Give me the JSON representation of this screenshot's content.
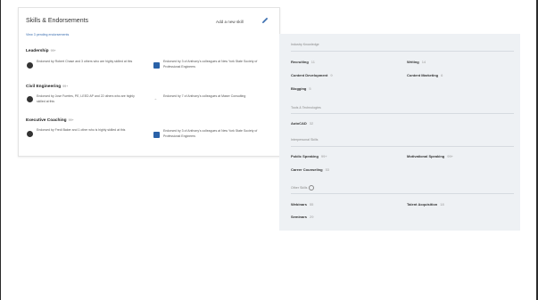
{
  "card": {
    "title": "Skills & Endorsements",
    "add_skill": "Add a new skill",
    "view_link": "View 3 pending endorsements",
    "skills": [
      {
        "name": "Leadership",
        "count": "99+",
        "left_text": "Endorsed by Robert Chase and 3 others who are highly skilled at this",
        "right_text": "Endorsed by 3 of Anthony's colleagues at New York State Society of Professional Engineers"
      },
      {
        "name": "Civil Engineering",
        "count": "99+",
        "left_text": "Endorsed by Jose Fuertes, PE, LEED AP and 22 others who are highly skilled at this",
        "right_text": "Endorsed by 7 of Anthony's colleagues at Maser Consulting"
      },
      {
        "name": "Executive Coaching",
        "count": "99+",
        "left_text": "Endorsed by Fredi Baker and 1 other who is highly skilled at this",
        "right_text": "Endorsed by 3 of Anthony's colleagues at New York State Society of Professional Engineers"
      }
    ]
  },
  "panel": {
    "sections": [
      {
        "title": "Industry Knowledge",
        "items": [
          {
            "name": "Recruiting",
            "count": "11"
          },
          {
            "name": "Writing",
            "count": "14"
          },
          {
            "name": "Content Development",
            "count": "9"
          },
          {
            "name": "Content Marketing",
            "count": "6"
          },
          {
            "name": "Blogging",
            "count": "5"
          }
        ]
      },
      {
        "title": "Tools & Technologies",
        "items": [
          {
            "name": "AutoCAD",
            "count": "32"
          }
        ]
      },
      {
        "title": "Interpersonal Skills",
        "items": [
          {
            "name": "Public Speaking",
            "count": "99+"
          },
          {
            "name": "Motivational Speaking",
            "count": "99+"
          },
          {
            "name": "Career Counseling",
            "count": "53"
          }
        ]
      },
      {
        "title": "Other Skills",
        "items": [
          {
            "name": "Webinars",
            "count": "55"
          },
          {
            "name": "Talent Acquisition",
            "count": "18"
          },
          {
            "name": "Seminars",
            "count": "29"
          }
        ]
      }
    ]
  },
  "colors": {
    "link": "#3c6fb0",
    "panel_bg": "#eef1f4",
    "logo_blue": "#2a62a8"
  }
}
